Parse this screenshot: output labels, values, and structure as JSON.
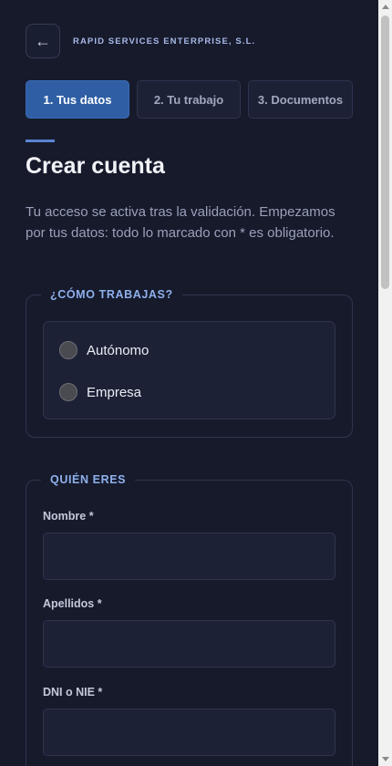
{
  "header": {
    "back_icon": "←",
    "company": "RAPID SERVICES ENTERPRISE, S.L."
  },
  "steps": [
    {
      "label": "1. Tus datos",
      "active": true
    },
    {
      "label": "2. Tu trabajo",
      "active": false
    },
    {
      "label": "3. Documentos",
      "active": false
    }
  ],
  "title": "Crear cuenta",
  "intro": "Tu acceso se activa tras la validación. Empezamos por tus datos: todo lo marcado con * es obligatorio.",
  "work_type": {
    "legend": "¿CÓMO TRABAJAS?",
    "options": [
      "Autónomo",
      "Empresa"
    ]
  },
  "identity": {
    "legend": "QUIÉN ERES",
    "fields": [
      {
        "label": "Nombre *",
        "value": ""
      },
      {
        "label": "Apellidos *",
        "value": ""
      },
      {
        "label": "DNI o NIE *",
        "value": ""
      }
    ]
  },
  "colors": {
    "background": "#161a2b",
    "accent": "#2f5ea5",
    "legend": "#8fb0ec"
  }
}
